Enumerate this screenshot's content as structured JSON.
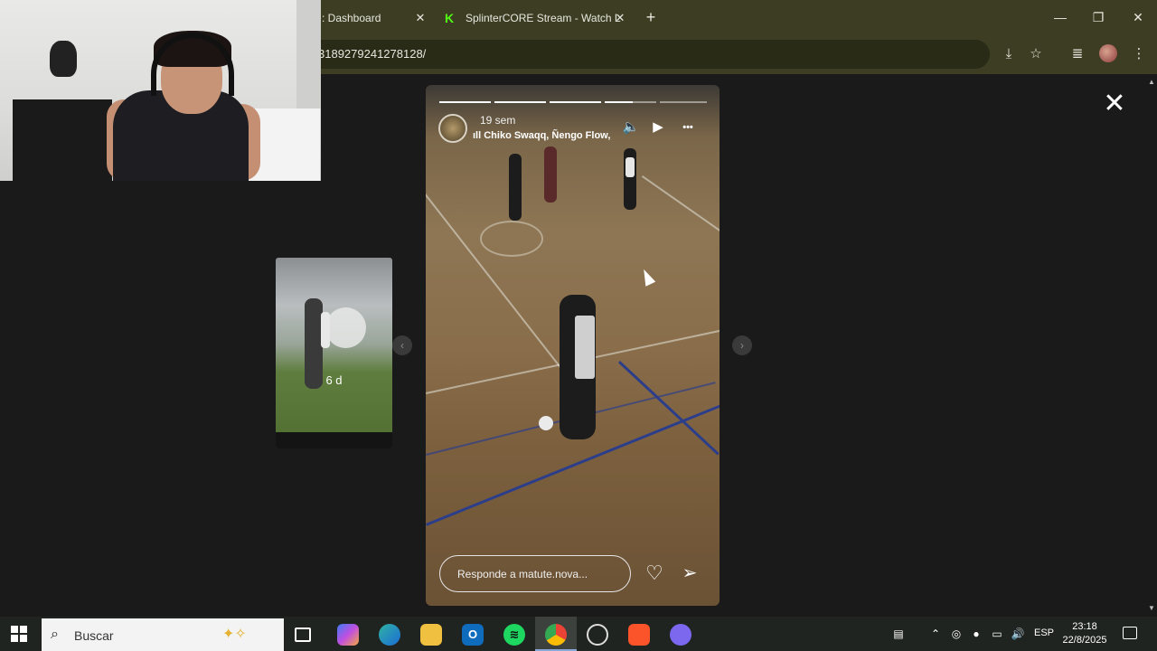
{
  "browser": {
    "tabs": [
      {
        "label": ": Dashboard",
        "close": "✕"
      },
      {
        "favicon": "K",
        "label": "SplinterCORE Stream - Watch L",
        "close": "✕"
      }
    ],
    "new_tab": "+",
    "url": "3189279241278128/",
    "window_controls": {
      "minimize": "—",
      "maximize": "❐",
      "close": "✕"
    },
    "toolbar_icons": [
      "install-icon",
      "star-icon",
      "media-icon",
      "profile-avatar",
      "menu-icon"
    ]
  },
  "viewer": {
    "close_label": "✕",
    "prev_story": {
      "time": "6 d"
    },
    "prev_arrow": "‹",
    "next_arrow": "›",
    "story": {
      "time": "19 sem",
      "music": "Chiko Swaqq, Ñengo Flow,",
      "progress": [
        1,
        1,
        1,
        0.55,
        0
      ],
      "reply_placeholder": "Responde a matute.nova...",
      "controls": {
        "mute": "🔈",
        "play": "▶",
        "more": "•••"
      }
    }
  },
  "taskbar": {
    "search_placeholder": "Buscar",
    "language": "ESP",
    "time": "23:18",
    "date": "22/8/2025",
    "apps": [
      "task-view",
      "copilot",
      "edge",
      "file-explorer",
      "outlook",
      "spotify",
      "chrome",
      "clock-app",
      "brave",
      "discord"
    ]
  },
  "colors": {
    "chrome_frame": "#3c3d22",
    "page_bg": "#1a1a1a",
    "kick_green": "#53fc18",
    "taskbar_bg": "#202421"
  }
}
